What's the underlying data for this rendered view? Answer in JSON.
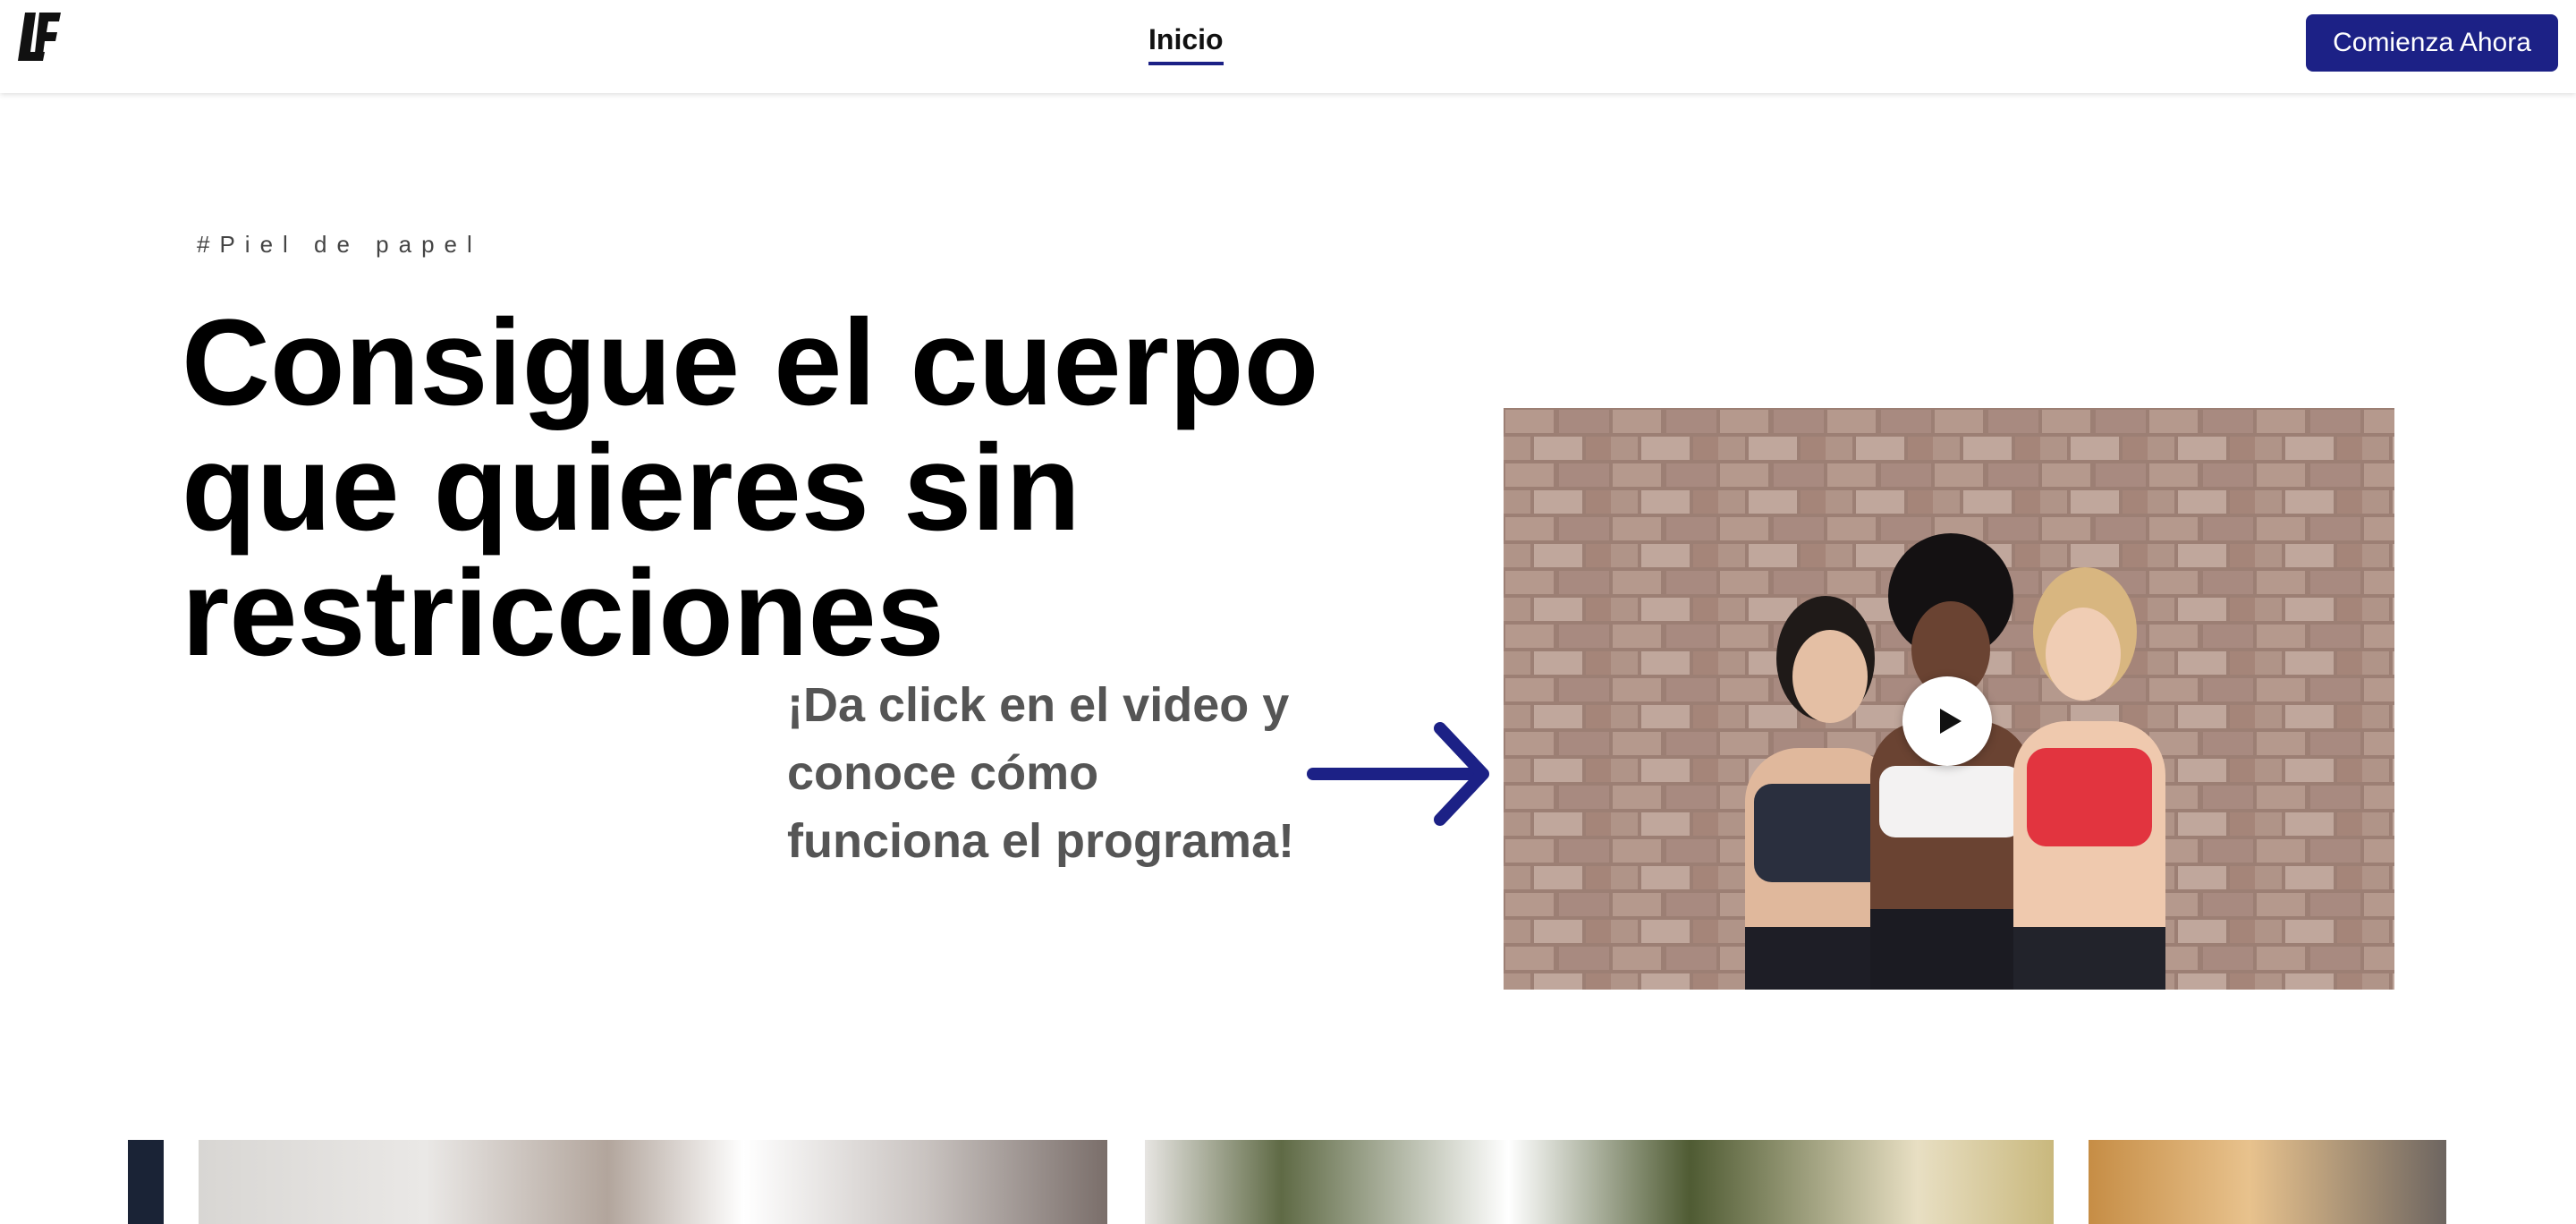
{
  "header": {
    "logo_text": "LF",
    "nav": {
      "home_label": "Inicio"
    },
    "cta_label": "Comienza Ahora"
  },
  "hero": {
    "tag": "#Piel de papel",
    "headline": "Consigue el cuerpo que quieres sin restricciones",
    "video_prompt": "¡Da click en el video y conoce cómo funciona el programa!"
  },
  "video": {
    "play_icon": "play-icon"
  },
  "colors": {
    "brand": "#1c2186",
    "headline": "#000000",
    "prompt": "#555555"
  }
}
